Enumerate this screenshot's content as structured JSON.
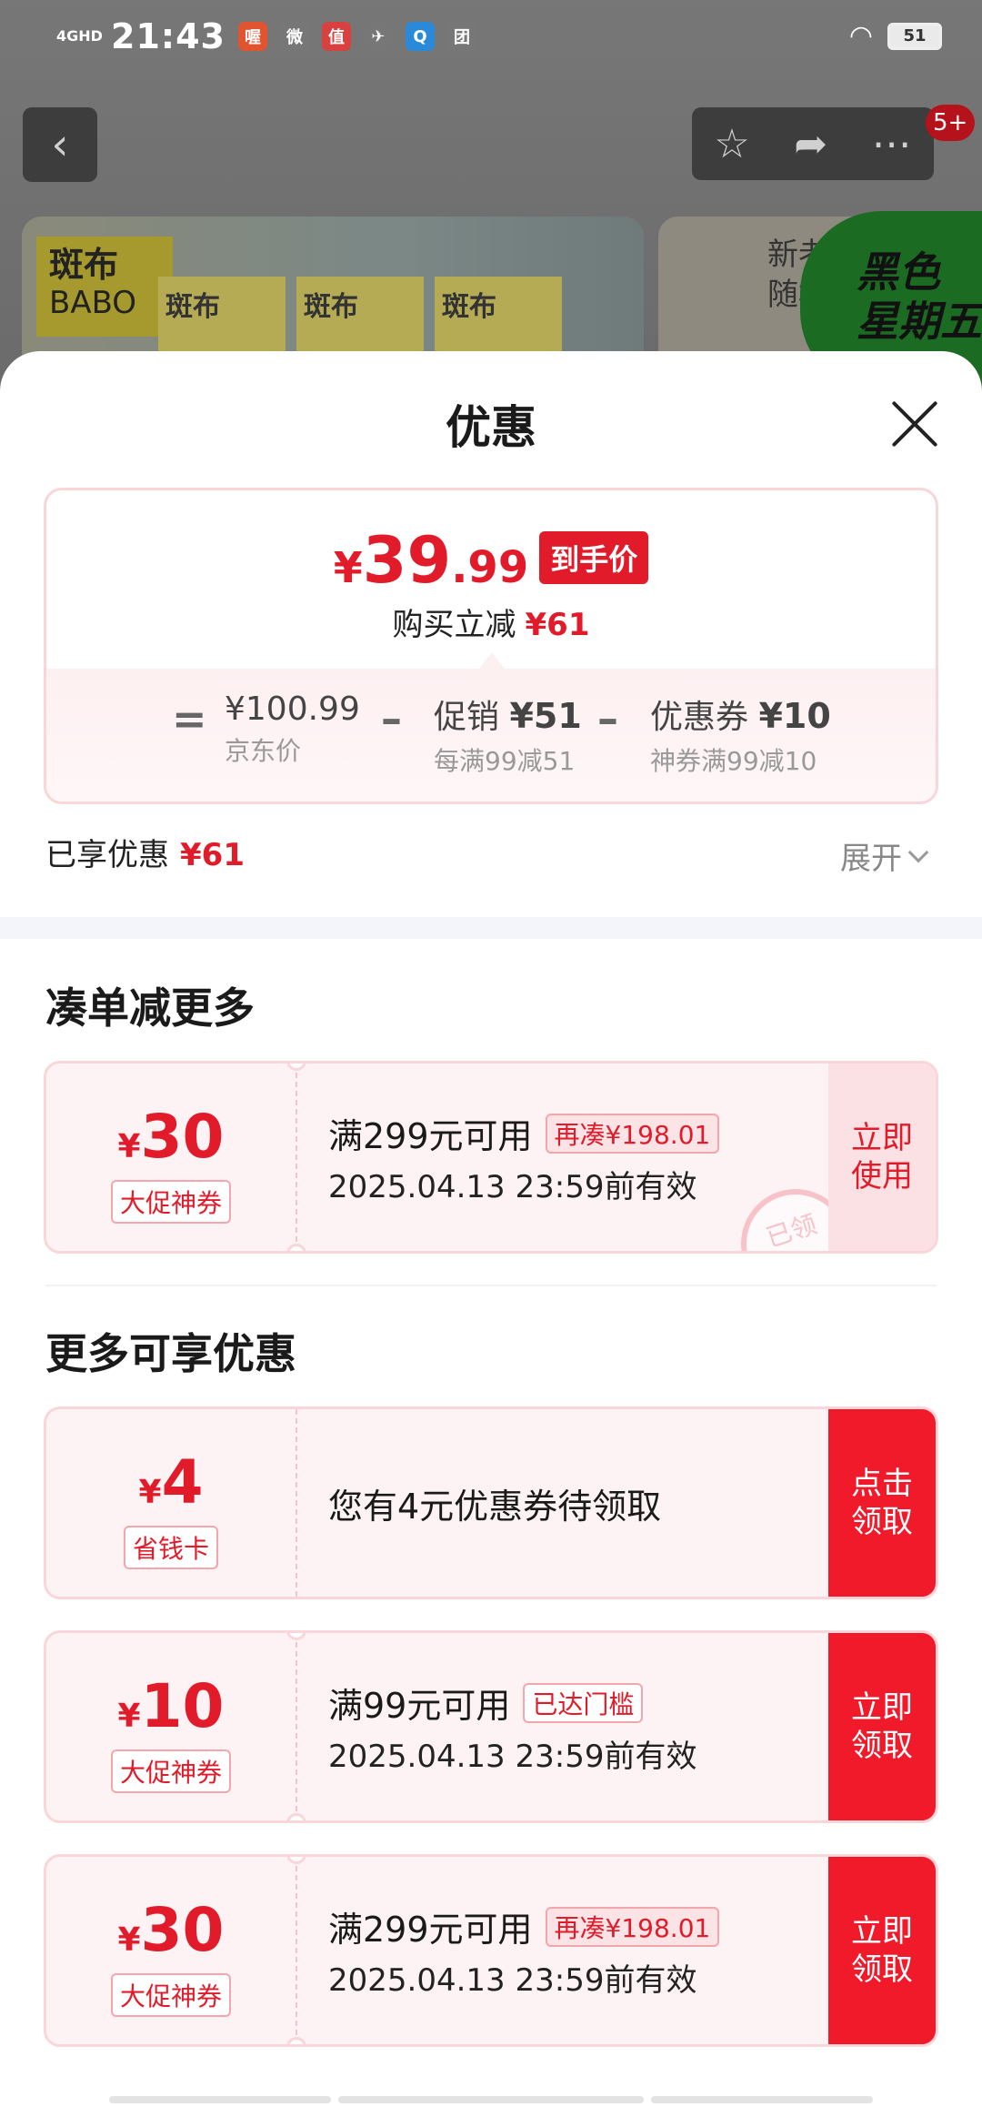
{
  "status_bar": {
    "network": "4GHD",
    "time": "21:43",
    "apps": [
      {
        "icon": "app-red-icon",
        "label": "喔",
        "color": "#e2532f"
      },
      {
        "icon": "weibo-icon",
        "label": "微",
        "color": "#777777"
      },
      {
        "icon": "smzdm-icon",
        "label": "值",
        "color": "#d94040"
      },
      {
        "icon": "bird-icon",
        "label": "✈",
        "color": "#777777"
      },
      {
        "icon": "qq-browser-icon",
        "label": "Q",
        "color": "#2b8ad8"
      },
      {
        "icon": "tuan-icon",
        "label": "团",
        "color": "#777777"
      }
    ],
    "battery": "51"
  },
  "background": {
    "badge": "5+",
    "brand_cn": "斑布",
    "brand_en": "BABO",
    "card2_text": [
      "新老",
      "随机"
    ],
    "black_friday": [
      "黑色",
      "星期五"
    ]
  },
  "sheet": {
    "title": "优惠",
    "price": {
      "currency": "¥",
      "integer": "39",
      "decimal": ".99",
      "tag": "到手价",
      "instant_label": "购买立减",
      "instant_amount": "¥61",
      "eq": "=",
      "minus": "–",
      "jd_price": "¥100.99",
      "jd_label": "京东价",
      "promo_label": "促销",
      "promo_amount": "¥51",
      "promo_sub": "每满99减51",
      "coupon_label": "优惠券",
      "coupon_amount": "¥10",
      "coupon_sub": "神券满99减10"
    },
    "enjoyed_label": "已享优惠",
    "enjoyed_amount": "¥61",
    "expand": "展开",
    "section1_title": "凑单减更多",
    "section2_title": "更多可享优惠",
    "coupons": [
      {
        "currency": "¥",
        "amount": "30",
        "type": "大促神券",
        "condition": "满299元可用",
        "tag": "再凑¥198.01",
        "valid": "2025.04.13 23:59前有效",
        "button": [
          "立即",
          "使用"
        ],
        "stamp": "已领"
      },
      {
        "currency": "¥",
        "amount": "4",
        "type": "省钱卡",
        "message": "您有4元优惠券待领取",
        "button": [
          "点击",
          "领取"
        ]
      },
      {
        "currency": "¥",
        "amount": "10",
        "type": "大促神券",
        "condition": "满99元可用",
        "tag": "已达门槛",
        "valid": "2025.04.13 23:59前有效",
        "button": [
          "立即",
          "领取"
        ]
      },
      {
        "currency": "¥",
        "amount": "30",
        "type": "大促神券",
        "condition": "满299元可用",
        "tag": "再凑¥198.01",
        "valid": "2025.04.13 23:59前有效",
        "button": [
          "立即",
          "领取"
        ]
      }
    ]
  },
  "colors": {
    "accent": "#e11b29",
    "button_red": "#f01a2b",
    "coupon_bg": "#fdf3f4",
    "border_pink": "#f9d6d9"
  }
}
